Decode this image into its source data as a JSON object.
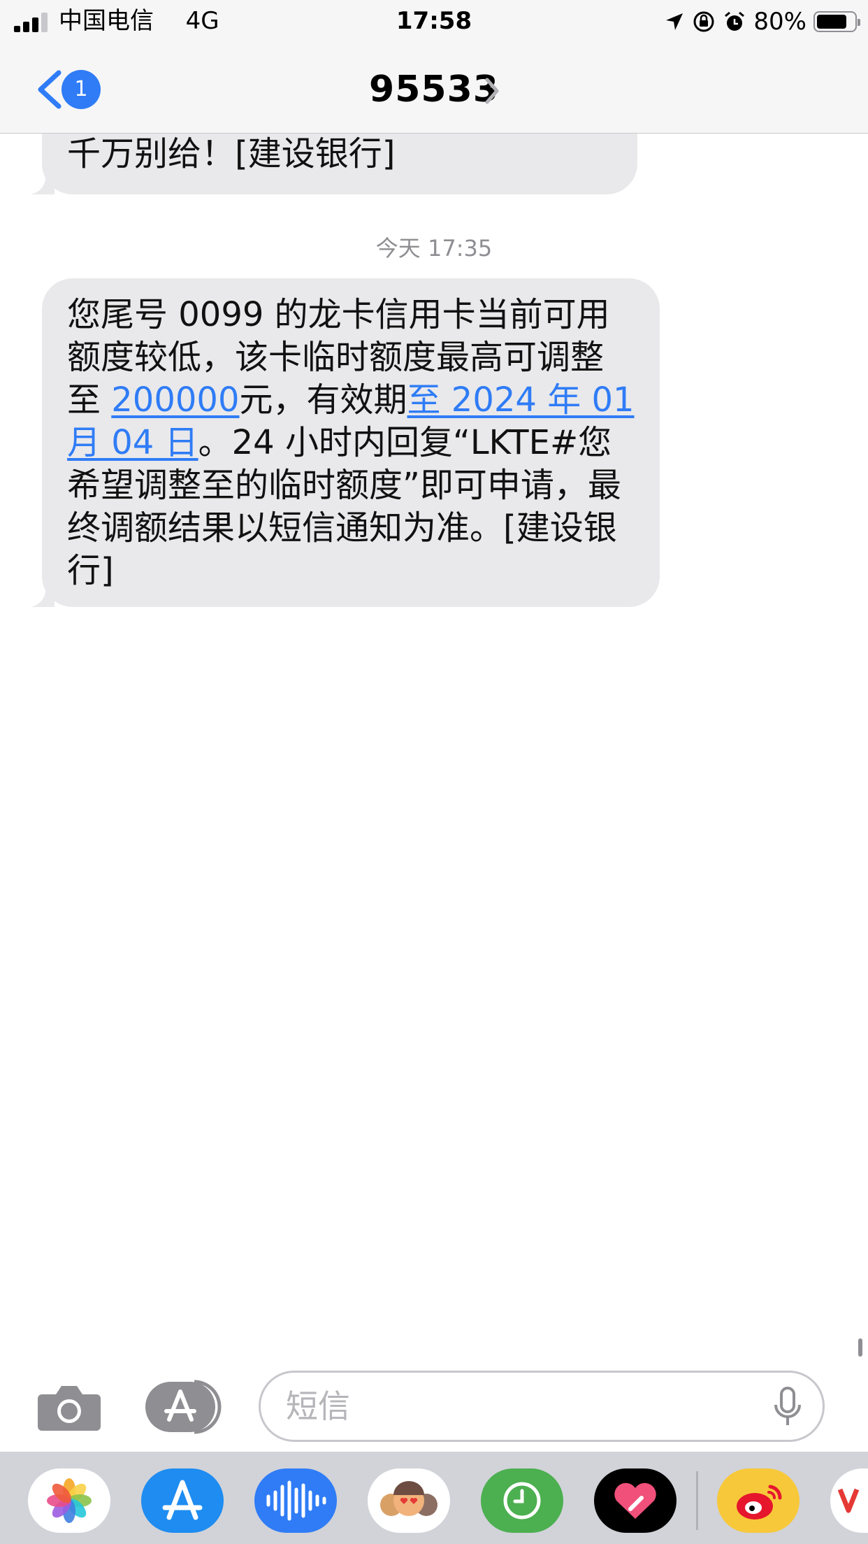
{
  "status_bar": {
    "carrier": "中国电信",
    "network": "4G",
    "time": "17:58",
    "battery_percent": "80%",
    "battery_level": 0.8
  },
  "nav": {
    "back_badge": "1",
    "title": "95533"
  },
  "messages": {
    "previous_tail": "千万别给！[建设银行]",
    "timestamp": "今天 17:35",
    "main": {
      "part1": "您尾号 0099 的龙卡信用卡当前可用额度较低，该卡临时额度最高可调整至 ",
      "link_amount": "200000",
      "part2": "元，有效期",
      "link_date": "至 2024 年 01 月 04 日",
      "part3": "。24 小时内回复“LKTE#您希望调整至的临时额度”即可申请，最终调额结果以短信通知为准。[建设银行]"
    }
  },
  "input": {
    "placeholder": "短信"
  },
  "icons": {
    "camera": "camera-icon",
    "app_store": "app-store-icon",
    "mic": "microphone-icon"
  },
  "app_drawer": [
    "photos-app",
    "app-store-app",
    "audio-message-app",
    "memoji-app",
    "digital-touch-app",
    "fitness-heart-app",
    "weibo-app",
    "partial-app"
  ],
  "colors": {
    "link": "#2f7cf6",
    "bubble": "#e9e9eb",
    "timestamp": "#8e8e93"
  }
}
